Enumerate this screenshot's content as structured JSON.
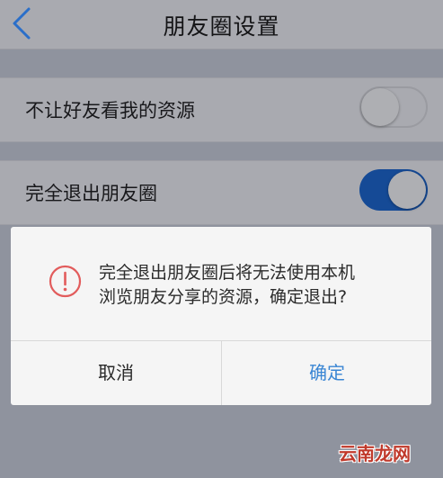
{
  "nav": {
    "title": "朋友圈设置",
    "back_icon": "chevron-left-icon"
  },
  "settings": {
    "rows": [
      {
        "label": "不让好友看我的资源",
        "toggle": "off"
      },
      {
        "label": "完全退出朋友圈",
        "toggle": "on"
      }
    ]
  },
  "dialog": {
    "icon": "warning-circle-icon",
    "message_line1": "完全退出朋友圈后将无法使用本机",
    "message_line2": "浏览朋友分享的资源，确定退出?",
    "cancel_label": "取消",
    "ok_label": "确定"
  },
  "watermark": {
    "text": "云南龙网"
  },
  "colors": {
    "accent": "#3a86d4",
    "toggle_on": "#154a96",
    "warning": "#e25c5c",
    "watermark": "#c0392b"
  }
}
